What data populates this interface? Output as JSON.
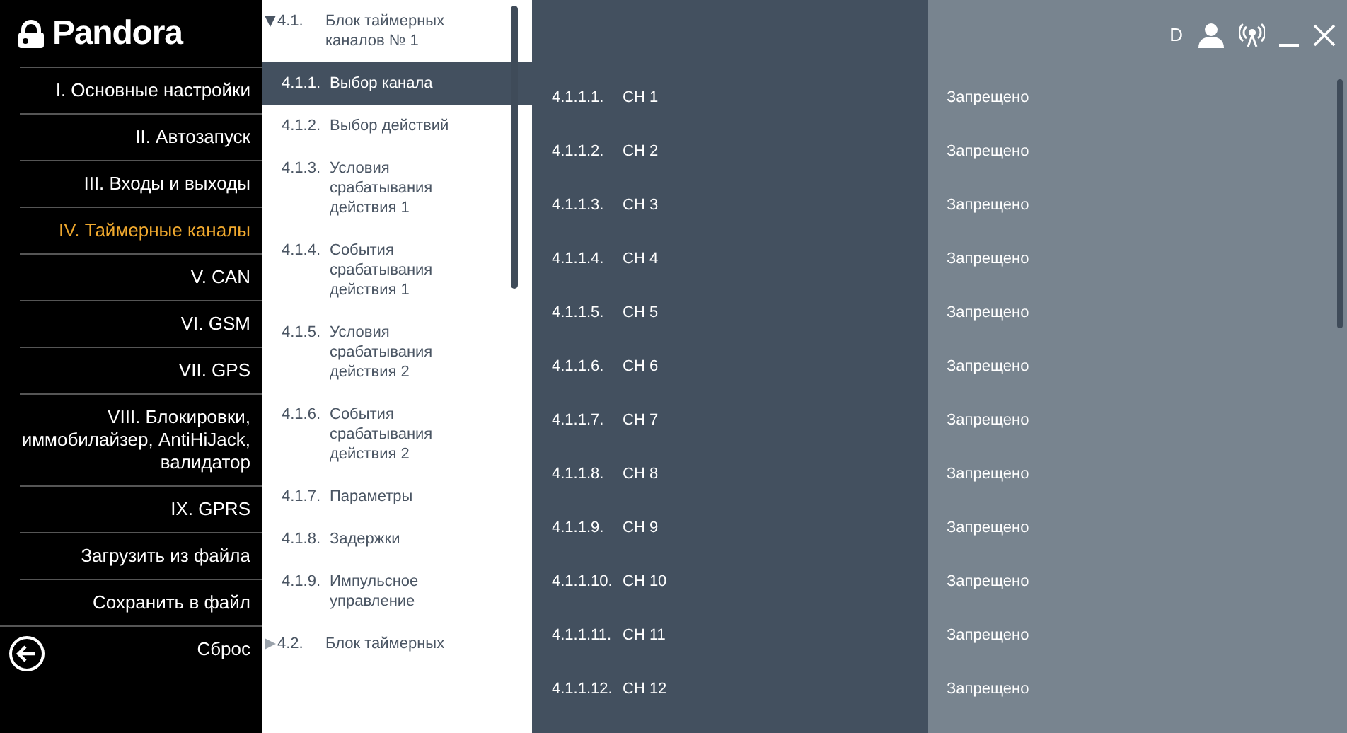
{
  "logo": {
    "text": "Pandora"
  },
  "menu": [
    {
      "label": "I. Основные настройки",
      "selected": false
    },
    {
      "label": "II. Автозапуск",
      "selected": false
    },
    {
      "label": "III. Входы и выходы",
      "selected": false
    },
    {
      "label": "IV. Таймерные каналы",
      "selected": true
    },
    {
      "label": "V. CAN",
      "selected": false
    },
    {
      "label": "VI. GSM",
      "selected": false
    },
    {
      "label": "VII. GPS",
      "selected": false
    },
    {
      "label": "VIII. Блокировки, иммобилайзер, AntiHiJack, валидатор",
      "selected": false
    },
    {
      "label": "IX. GPRS",
      "selected": false
    },
    {
      "label": "Загрузить из файла",
      "selected": false
    },
    {
      "label": "Сохранить в файл",
      "selected": false
    },
    {
      "label": "Сброс",
      "selected": false
    }
  ],
  "tree": [
    {
      "number": "4.1.",
      "label": "Блок таймерных каналов № 1",
      "expanded": true,
      "children": [
        {
          "number": "4.1.1.",
          "label": "Выбор канала",
          "selected": true
        },
        {
          "number": "4.1.2.",
          "label": "Выбор действий",
          "selected": false
        },
        {
          "number": "4.1.3.",
          "label": "Условия срабатывания действия 1",
          "selected": false
        },
        {
          "number": "4.1.4.",
          "label": "События срабатывания действия 1",
          "selected": false
        },
        {
          "number": "4.1.5.",
          "label": "Условия срабатывания действия 2",
          "selected": false
        },
        {
          "number": "4.1.6.",
          "label": "События срабатывания действия 2",
          "selected": false
        },
        {
          "number": "4.1.7.",
          "label": "Параметры",
          "selected": false
        },
        {
          "number": "4.1.8.",
          "label": "Задержки",
          "selected": false
        },
        {
          "number": "4.1.9.",
          "label": "Импульсное управление",
          "selected": false
        }
      ]
    },
    {
      "number": "4.2.",
      "label": "Блок таймерных",
      "expanded": false
    }
  ],
  "header": {
    "user_letter": "D"
  },
  "channels": [
    {
      "number": "4.1.1.1.",
      "name": "CH 1",
      "value": "Запрещено"
    },
    {
      "number": "4.1.1.2.",
      "name": "CH 2",
      "value": "Запрещено"
    },
    {
      "number": "4.1.1.3.",
      "name": "CH 3",
      "value": "Запрещено"
    },
    {
      "number": "4.1.1.4.",
      "name": "CH 4",
      "value": "Запрещено"
    },
    {
      "number": "4.1.1.5.",
      "name": "CH 5",
      "value": "Запрещено"
    },
    {
      "number": "4.1.1.6.",
      "name": "CH 6",
      "value": "Запрещено"
    },
    {
      "number": "4.1.1.7.",
      "name": "CH 7",
      "value": "Запрещено"
    },
    {
      "number": "4.1.1.8.",
      "name": "CH 8",
      "value": "Запрещено"
    },
    {
      "number": "4.1.1.9.",
      "name": "CH 9",
      "value": "Запрещено"
    },
    {
      "number": "4.1.1.10.",
      "name": "CH 10",
      "value": "Запрещено"
    },
    {
      "number": "4.1.1.11.",
      "name": "CH 11",
      "value": "Запрещено"
    },
    {
      "number": "4.1.1.12.",
      "name": "CH 12",
      "value": "Запрещено"
    }
  ]
}
